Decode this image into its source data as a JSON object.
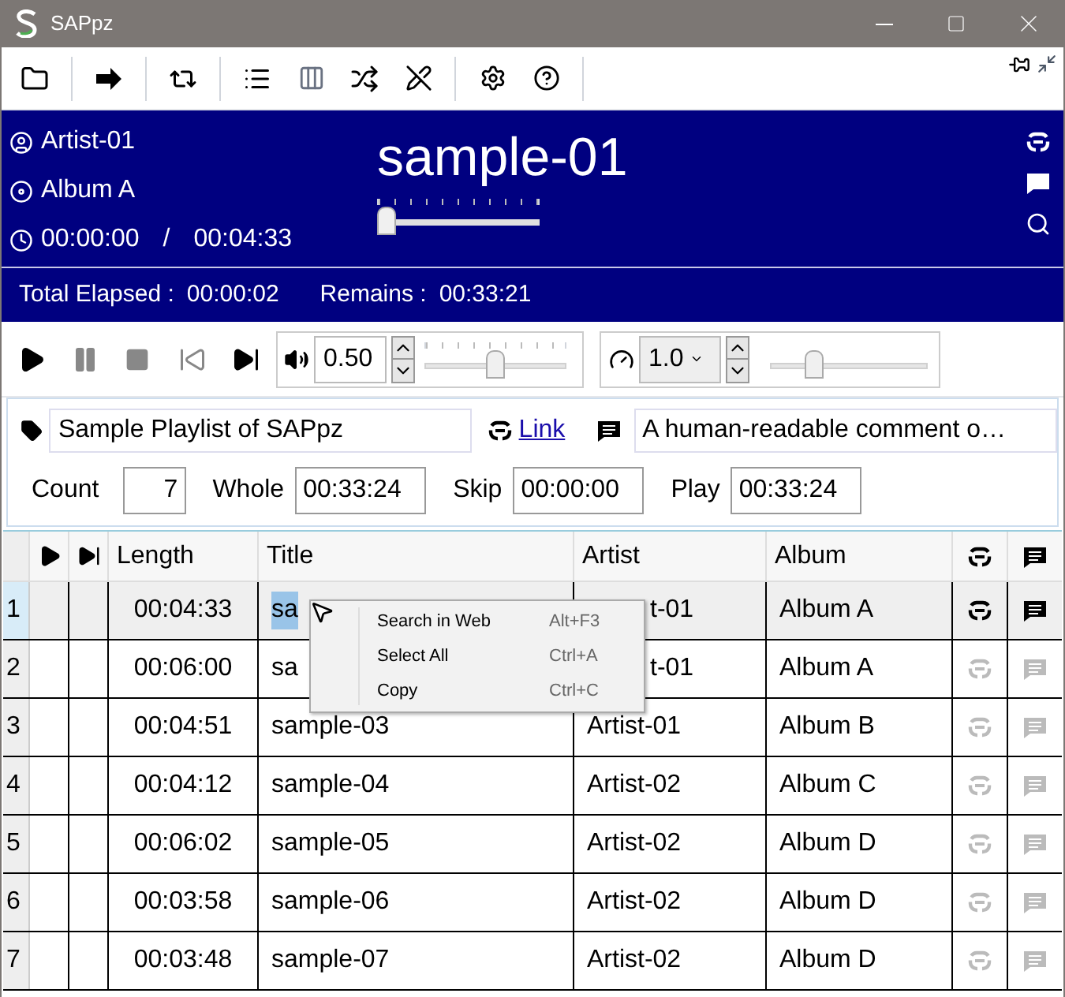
{
  "window": {
    "title": "SAPpz"
  },
  "now_playing": {
    "artist": "Artist-01",
    "album": "Album A",
    "elapsed": "00:00:00",
    "separator": "/",
    "duration": "00:04:33",
    "title": "sample-01",
    "seek": {
      "level": 0
    }
  },
  "status": {
    "elapsed_label": "Total Elapsed :",
    "elapsed": "00:00:02",
    "remains_label": "Remains :",
    "remains": "00:33:21"
  },
  "volume": {
    "value": "0.50",
    "level": 0.5
  },
  "speed": {
    "value": "1.0",
    "level": 0.25
  },
  "playlist": {
    "name": "Sample Playlist of SAPpz",
    "link": "Link",
    "comment": "A human-readable comment o…"
  },
  "stats": [
    {
      "label": "Count",
      "value": "7"
    },
    {
      "label": "Whole",
      "value": "00:33:24"
    },
    {
      "label": "Skip",
      "value": "00:00:00"
    },
    {
      "label": "Play",
      "value": "00:33:24"
    }
  ],
  "table": {
    "columns": [
      "Length",
      "Title",
      "Artist",
      "Album"
    ],
    "rows": [
      {
        "index": "1",
        "length": "00:04:33",
        "title": "sa",
        "artist": "t-01",
        "album": "Album A",
        "selected": true,
        "covered": true
      },
      {
        "index": "2",
        "length": "00:06:00",
        "title": "sa",
        "artist": "t-01",
        "album": "Album A",
        "selected": false,
        "covered": true
      },
      {
        "index": "3",
        "length": "00:04:51",
        "title": "sample-03",
        "artist": "Artist-01",
        "album": "Album B",
        "selected": false,
        "covered": false
      },
      {
        "index": "4",
        "length": "00:04:12",
        "title": "sample-04",
        "artist": "Artist-02",
        "album": "Album C",
        "selected": false,
        "covered": false
      },
      {
        "index": "5",
        "length": "00:06:02",
        "title": "sample-05",
        "artist": "Artist-02",
        "album": "Album D",
        "selected": false,
        "covered": false
      },
      {
        "index": "6",
        "length": "00:03:58",
        "title": "sample-06",
        "artist": "Artist-02",
        "album": "Album D",
        "selected": false,
        "covered": false
      },
      {
        "index": "7",
        "length": "00:03:48",
        "title": "sample-07",
        "artist": "Artist-02",
        "album": "Album D",
        "selected": false,
        "covered": false
      }
    ]
  },
  "context_menu": [
    {
      "label": "Search in Web",
      "shortcut": "Alt+F3"
    },
    {
      "label": "Select All",
      "shortcut": "Ctrl+A"
    },
    {
      "label": "Copy",
      "shortcut": "Ctrl+C"
    }
  ]
}
